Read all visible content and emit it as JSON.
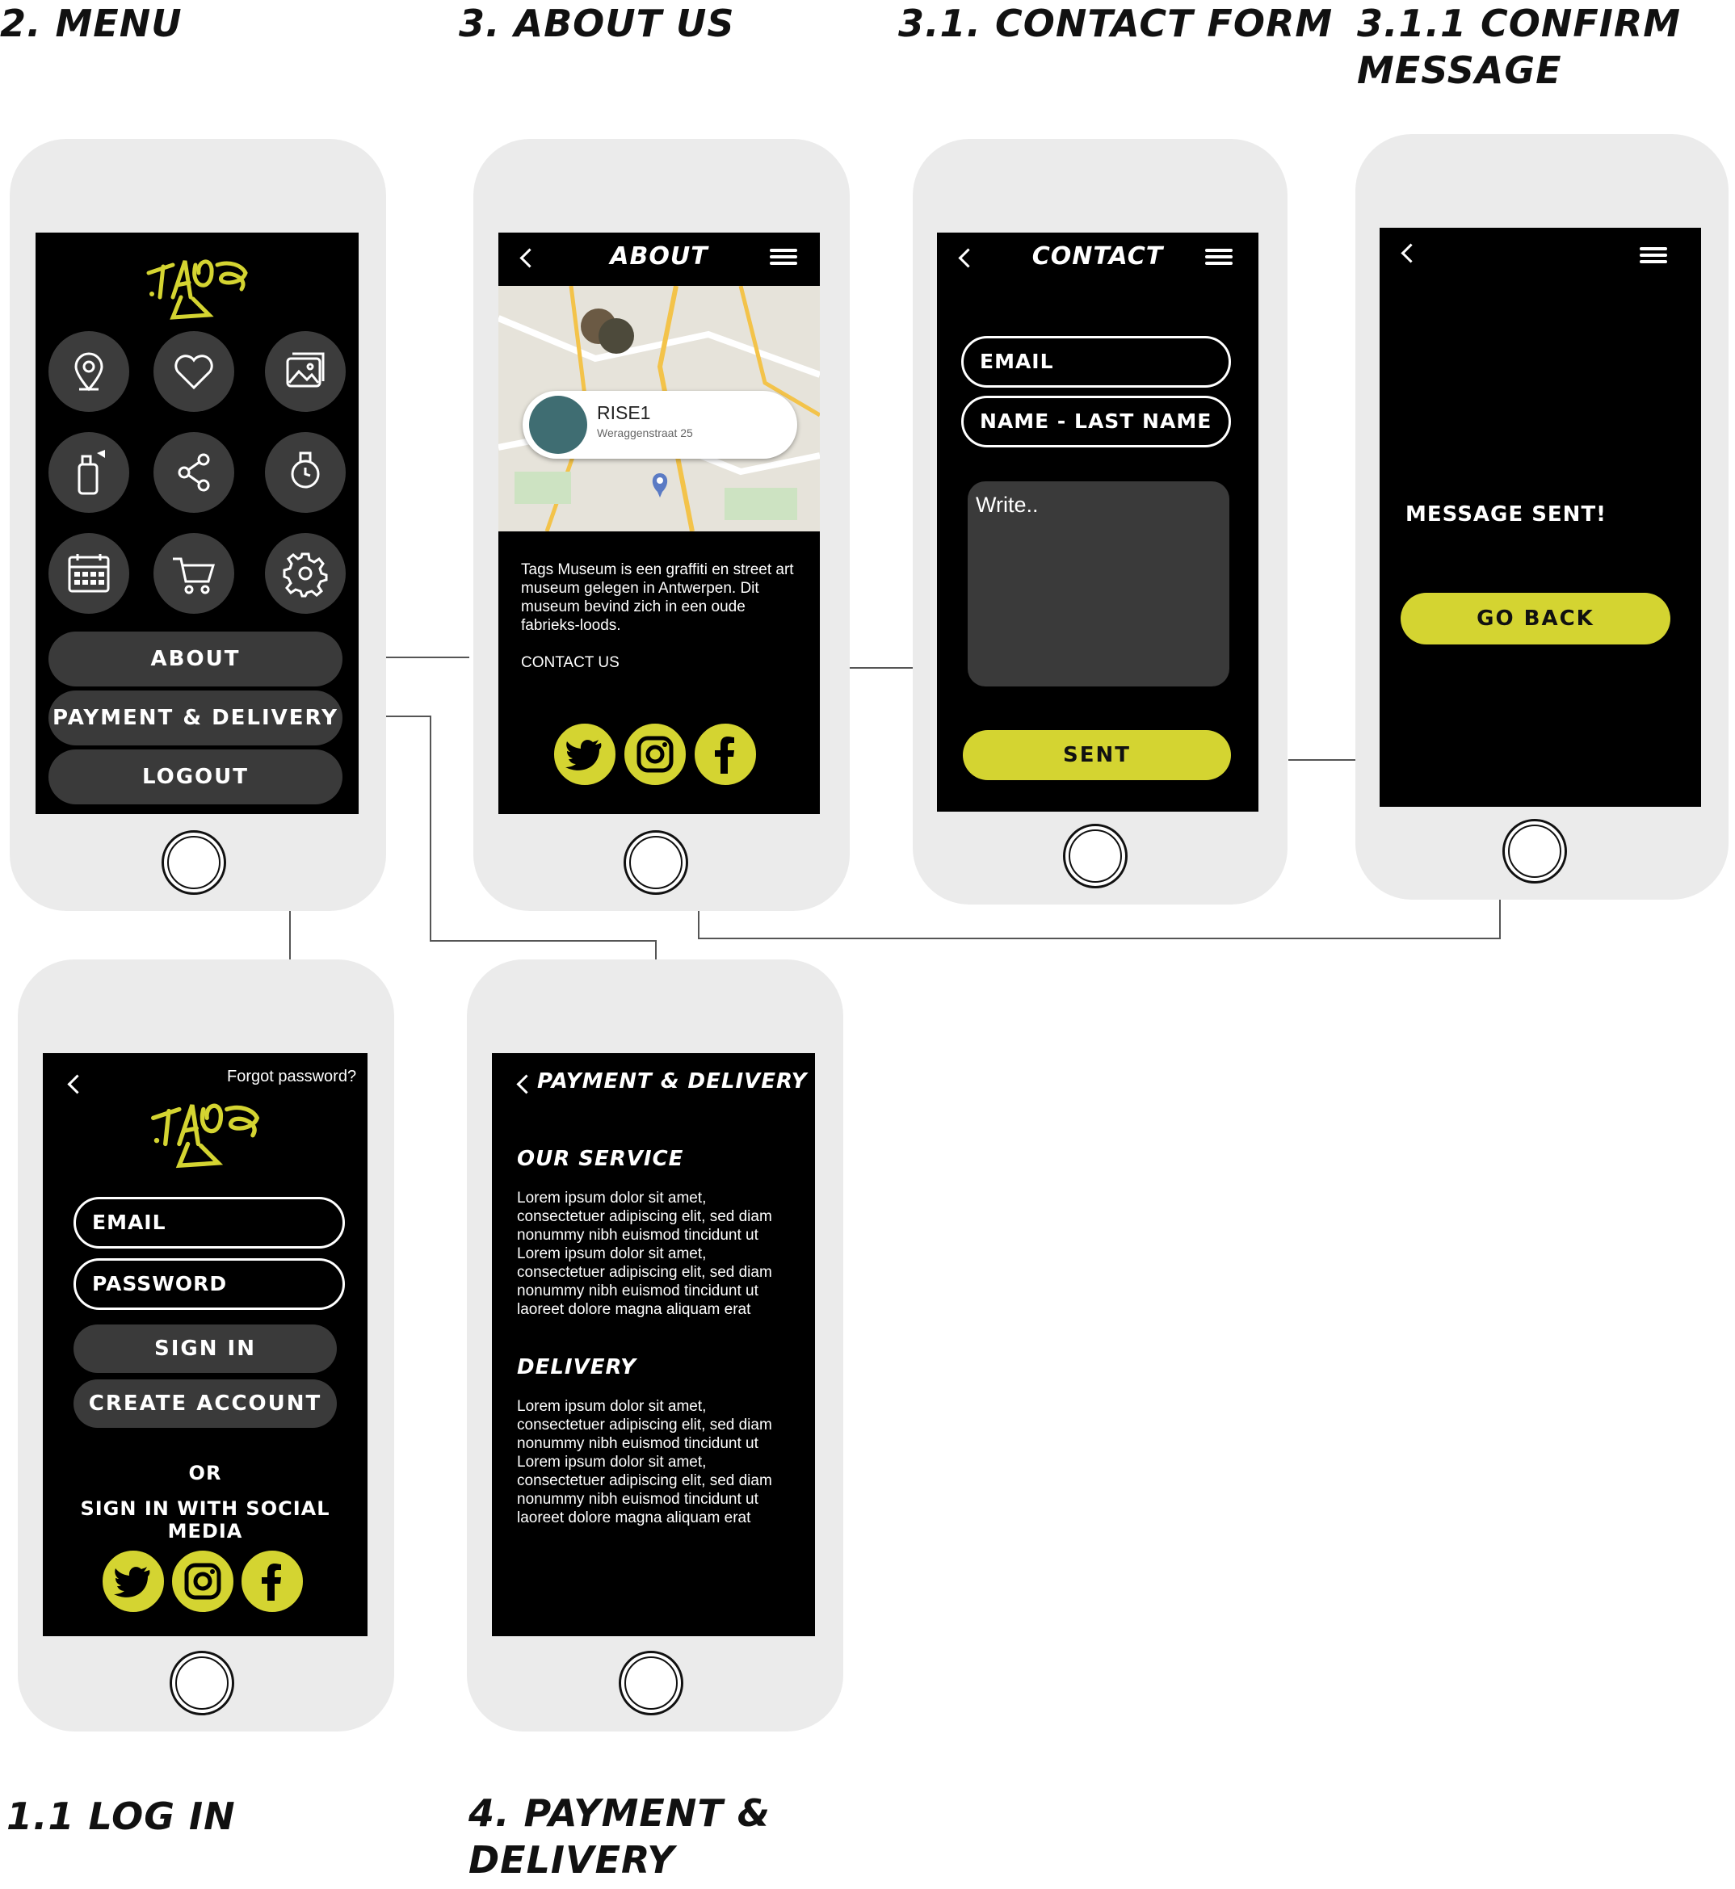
{
  "titles": {
    "menu": "2. MENU",
    "about": "3. ABOUT US",
    "contact": "3.1. CONTACT FORM",
    "confirm_line1": "3.1.1 CONFIRM",
    "confirm_line2": "MESSAGE",
    "login": "1.1 LOG IN",
    "payment_line1": "4. PAYMENT &",
    "payment_line2": "DELIVERY"
  },
  "brand": {
    "logo_text": "TAGS",
    "accent_color": "#d4d431"
  },
  "menu": {
    "icons": [
      "location-pin-icon",
      "heart-icon",
      "gallery-icon",
      "spray-can-icon",
      "share-icon",
      "watch-icon",
      "calendar-icon",
      "cart-icon",
      "settings-gear-icon"
    ],
    "about_label": "ABOUT",
    "payment_label": "PAYMENT & DELIVERY",
    "logout_label": "LOGOUT"
  },
  "about": {
    "title": "ABOUT",
    "pin_name": "RISE1",
    "pin_address": "Weraggenstraat 25",
    "description": "Tags Museum is een graffiti en street art museum gelegen in Antwerpen. Dit museum bevind zich in een oude fabrieks-loods.",
    "contact_link": "CONTACT US",
    "social": [
      "twitter-icon",
      "instagram-icon",
      "facebook-icon"
    ]
  },
  "contact": {
    "title": "CONTACT",
    "email_placeholder": "EMAIL",
    "name_placeholder": "NAME - LAST NAME",
    "message_placeholder": "Write..",
    "submit_label": "SENT"
  },
  "confirm": {
    "message": "MESSAGE SENT!",
    "back_label": "GO BACK"
  },
  "login": {
    "forgot": "Forgot password?",
    "email_placeholder": "EMAIL",
    "password_placeholder": "PASSWORD",
    "signin_label": "SIGN IN",
    "create_label": "CREATE ACCOUNT",
    "or_text": "OR",
    "social_text": "SIGN IN WITH SOCIAL MEDIA"
  },
  "payment": {
    "title": "PAYMENT & DELIVERY",
    "service_heading": "OUR SERVICE",
    "service_text": "Lorem ipsum dolor sit amet, consectetuer adipiscing elit, sed diam nonummy nibh euismod tincidunt ut Lorem ipsum dolor sit amet, consectetuer adipiscing elit, sed diam nonummy nibh euismod tincidunt ut laoreet dolore magna aliquam erat",
    "delivery_heading": "DELIVERY",
    "delivery_text": "Lorem ipsum dolor sit amet, consectetuer adipiscing elit, sed diam nonummy nibh euismod tincidunt ut Lorem ipsum dolor sit amet, consectetuer adipiscing elit, sed diam nonummy nibh euismod tincidunt ut laoreet dolore magna aliquam erat"
  }
}
